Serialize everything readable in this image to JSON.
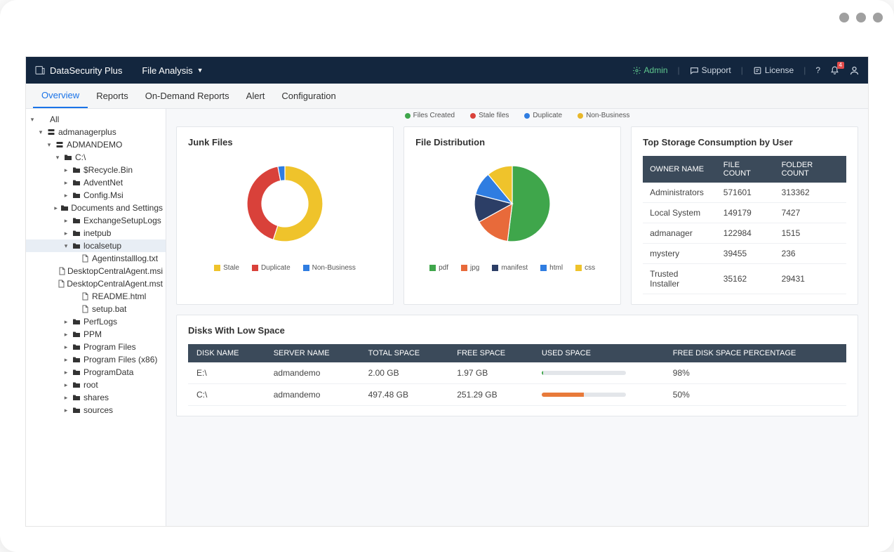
{
  "brand": "DataSecurity Plus",
  "module": "File Analysis",
  "topbar": {
    "admin": "Admin",
    "support": "Support",
    "license": "License",
    "badge": "4"
  },
  "tabs": [
    "Overview",
    "Reports",
    "On-Demand Reports",
    "Alert",
    "Configuration"
  ],
  "active_tab": 0,
  "top_legend": [
    {
      "label": "Files Created",
      "color": "#3fa64b"
    },
    {
      "label": "Stale files",
      "color": "#d9413a"
    },
    {
      "label": "Duplicate",
      "color": "#2f7de1"
    },
    {
      "label": "Non-Business",
      "color": "#e8b72a"
    }
  ],
  "tree": [
    {
      "depth": 0,
      "caret": "down",
      "icon": "",
      "label": "All"
    },
    {
      "depth": 1,
      "caret": "down",
      "icon": "server",
      "label": "admanagerplus"
    },
    {
      "depth": 2,
      "caret": "down",
      "icon": "server",
      "label": "ADMANDEMO"
    },
    {
      "depth": 3,
      "caret": "down",
      "icon": "folder",
      "label": "C:\\"
    },
    {
      "depth": 4,
      "caret": "right",
      "icon": "folder",
      "label": "$Recycle.Bin"
    },
    {
      "depth": 4,
      "caret": "right",
      "icon": "folder",
      "label": "AdventNet"
    },
    {
      "depth": 4,
      "caret": "right",
      "icon": "folder",
      "label": "Config.Msi"
    },
    {
      "depth": 4,
      "caret": "right",
      "icon": "folder",
      "label": "Documents and Settings"
    },
    {
      "depth": 4,
      "caret": "right",
      "icon": "folder",
      "label": "ExchangeSetupLogs"
    },
    {
      "depth": 4,
      "caret": "right",
      "icon": "folder",
      "label": "inetpub"
    },
    {
      "depth": 4,
      "caret": "down",
      "icon": "folder",
      "label": "localsetup",
      "selected": true
    },
    {
      "depth": 5,
      "caret": "",
      "icon": "file",
      "label": "Agentinstalllog.txt"
    },
    {
      "depth": 5,
      "caret": "",
      "icon": "file",
      "label": "DesktopCentralAgent.msi"
    },
    {
      "depth": 5,
      "caret": "",
      "icon": "file",
      "label": "DesktopCentralAgent.mst"
    },
    {
      "depth": 5,
      "caret": "",
      "icon": "file",
      "label": "README.html"
    },
    {
      "depth": 5,
      "caret": "",
      "icon": "file",
      "label": "setup.bat"
    },
    {
      "depth": 4,
      "caret": "right",
      "icon": "folder",
      "label": "PerfLogs"
    },
    {
      "depth": 4,
      "caret": "right",
      "icon": "folder",
      "label": "PPM"
    },
    {
      "depth": 4,
      "caret": "right",
      "icon": "folder",
      "label": "Program Files"
    },
    {
      "depth": 4,
      "caret": "right",
      "icon": "folder",
      "label": "Program Files (x86)"
    },
    {
      "depth": 4,
      "caret": "right",
      "icon": "folder",
      "label": "ProgramData"
    },
    {
      "depth": 4,
      "caret": "right",
      "icon": "folder",
      "label": "root"
    },
    {
      "depth": 4,
      "caret": "right",
      "icon": "folder",
      "label": "shares"
    },
    {
      "depth": 4,
      "caret": "right",
      "icon": "folder",
      "label": "sources"
    }
  ],
  "cards": {
    "junk": {
      "title": "Junk Files",
      "legend": [
        {
          "label": "Stale",
          "color": "#efc32b"
        },
        {
          "label": "Duplicate",
          "color": "#d9413a"
        },
        {
          "label": "Non-Business",
          "color": "#2f7de1"
        }
      ]
    },
    "dist": {
      "title": "File Distribution",
      "legend": [
        {
          "label": "pdf",
          "color": "#3fa64b"
        },
        {
          "label": "jpg",
          "color": "#e86a3a"
        },
        {
          "label": "manifest",
          "color": "#2c3e66"
        },
        {
          "label": "html",
          "color": "#2f7de1"
        },
        {
          "label": "css",
          "color": "#efc32b"
        }
      ]
    },
    "storage": {
      "title": "Top Storage Consumption by User",
      "headers": [
        "OWNER NAME",
        "FILE COUNT",
        "FOLDER COUNT"
      ],
      "rows": [
        [
          "Administrators",
          "571601",
          "313362"
        ],
        [
          "Local System",
          "149179",
          "7427"
        ],
        [
          "admanager",
          "122984",
          "1515"
        ],
        [
          "mystery",
          "39455",
          "236"
        ],
        [
          "Trusted Installer",
          "35162",
          "29431"
        ]
      ]
    }
  },
  "disks": {
    "title": "Disks With Low Space",
    "headers": [
      "DISK NAME",
      "SERVER NAME",
      "TOTAL SPACE",
      "FREE SPACE",
      "USED SPACE",
      "FREE DISK SPACE PERCENTAGE"
    ],
    "rows": [
      {
        "disk": "E:\\",
        "server": "admandemo",
        "total": "2.00 GB",
        "free": "1.97 GB",
        "used_pct": 2,
        "used_color": "#3fa64b",
        "pct": "98%"
      },
      {
        "disk": "C:\\",
        "server": "admandemo",
        "total": "497.48 GB",
        "free": "251.29 GB",
        "used_pct": 50,
        "used_color": "#e87a3a",
        "pct": "50%"
      }
    ]
  },
  "chart_data": [
    {
      "type": "pie",
      "title": "Junk Files",
      "donut": true,
      "series": [
        {
          "name": "Stale",
          "value": 55,
          "color": "#efc32b"
        },
        {
          "name": "Duplicate",
          "value": 42,
          "color": "#d9413a"
        },
        {
          "name": "Non-Business",
          "value": 3,
          "color": "#2f7de1"
        }
      ]
    },
    {
      "type": "pie",
      "title": "File Distribution",
      "donut": false,
      "series": [
        {
          "name": "pdf",
          "value": 52,
          "color": "#3fa64b"
        },
        {
          "name": "jpg",
          "value": 15,
          "color": "#e86a3a"
        },
        {
          "name": "manifest",
          "value": 12,
          "color": "#2c3e66"
        },
        {
          "name": "html",
          "value": 10,
          "color": "#2f7de1"
        },
        {
          "name": "css",
          "value": 11,
          "color": "#efc32b"
        }
      ]
    }
  ]
}
